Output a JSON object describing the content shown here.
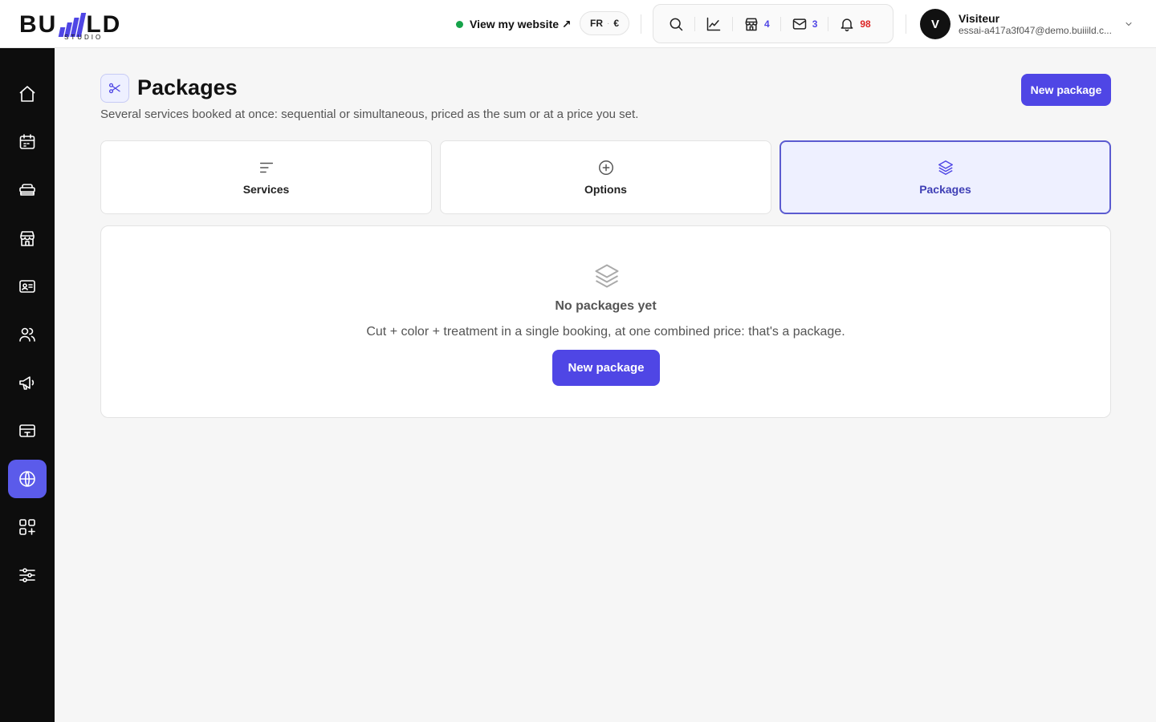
{
  "brand": {
    "name_left": "BU",
    "name_right": "LD",
    "subtitle": "STUDIO",
    "accent": "#4f46e5"
  },
  "header": {
    "view_site": "View my website ↗",
    "lang": "FR",
    "currency": "€",
    "stats": {
      "shop_count": "4",
      "mail_count": "3",
      "notif_count": "98"
    },
    "user": {
      "initial": "V",
      "name": "Visiteur",
      "email": "essai-a417a3f047@demo.buiiild.c..."
    }
  },
  "sidebar": {
    "items": [
      {
        "icon": "home-icon"
      },
      {
        "icon": "calendar-icon"
      },
      {
        "icon": "services-icon"
      },
      {
        "icon": "store-icon"
      },
      {
        "icon": "contact-card-icon"
      },
      {
        "icon": "users-icon"
      },
      {
        "icon": "megaphone-icon"
      },
      {
        "icon": "payment-icon"
      },
      {
        "icon": "globe-icon",
        "active": true
      },
      {
        "icon": "apps-add-icon"
      },
      {
        "icon": "settings-sliders-icon"
      }
    ]
  },
  "page": {
    "icon": "scissors-icon",
    "title": "Packages",
    "description": "Several services booked at once: sequential or simultaneous, priced as the sum or at a price you set.",
    "new_button": "New package"
  },
  "tabs": [
    {
      "label": "Services",
      "icon": "lines-icon"
    },
    {
      "label": "Options",
      "icon": "plus-circle-icon"
    },
    {
      "label": "Packages",
      "icon": "layers-icon",
      "active": true
    }
  ],
  "empty_state": {
    "icon": "layers-icon",
    "title": "No packages yet",
    "description": "Cut + color + treatment in a single booking, at one combined price: that's a package.",
    "button": "New package"
  }
}
